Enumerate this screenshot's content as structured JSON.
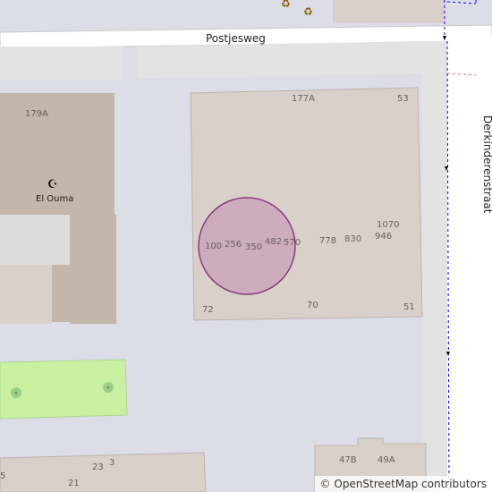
{
  "streets": {
    "postjesweg": "Postjesweg",
    "derkinderenstraat": "Derkinderenstraat"
  },
  "poi": {
    "name": "El Ouma",
    "icon": "crescent-star-icon",
    "recycling_icon": "recycling-icon"
  },
  "housenumbers": {
    "n179a": "179A",
    "n177a": "177A",
    "n53": "53",
    "n100": "100",
    "n256": "256",
    "n350": "350",
    "n482": "482",
    "n570": "570",
    "n778": "778",
    "n830": "830",
    "n1070": "1070",
    "n946": "946",
    "n72": "72",
    "n70": "70",
    "n51": "51",
    "n5": "5",
    "n23": "23",
    "n3": "3",
    "n21": "21",
    "n47b": "47B",
    "n49a": "49A"
  },
  "attribution": {
    "symbol": "©",
    "text": "OpenStreetMap contributors"
  },
  "colors": {
    "background": "#dddde8",
    "building": "#d9d0c9",
    "building_dark": "#c4b6ab",
    "park": "#c8f0a0",
    "road": "#ffffff",
    "marker_fill": "#c8a0b8",
    "marker_stroke": "#8a3a80",
    "footway": "#0000ff"
  }
}
